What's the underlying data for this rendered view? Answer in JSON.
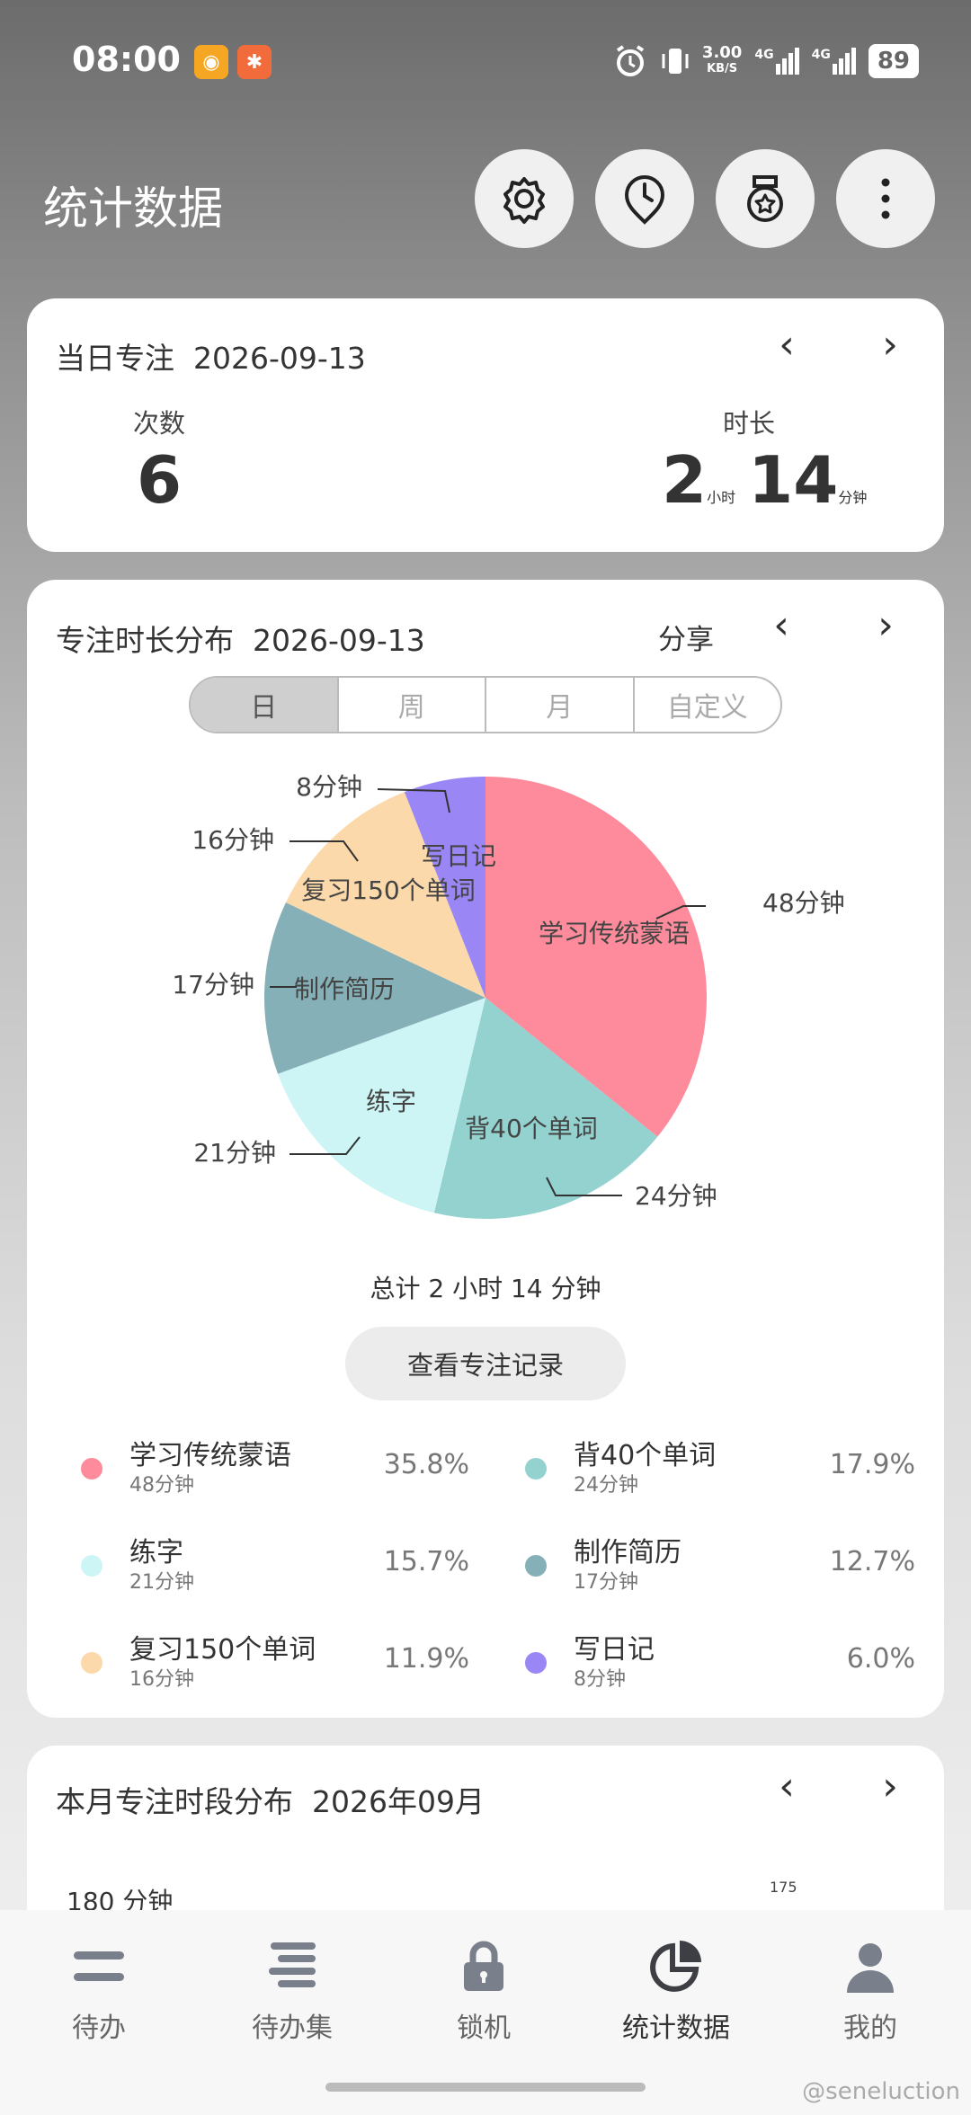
{
  "status": {
    "time": "08:00",
    "net_speed_top": "3.00",
    "net_speed_bottom": "KB/S",
    "sig1": "4G",
    "sig2": "4G",
    "battery": "89"
  },
  "header": {
    "title": "统计数据"
  },
  "daily": {
    "title": "当日专注",
    "date": "2026-09-13",
    "count_label": "次数",
    "count": "6",
    "duration_label": "时长",
    "hours": "2",
    "hours_unit": "小时",
    "minutes": "14",
    "minutes_unit": "分钟"
  },
  "distribution": {
    "title": "专注时长分布",
    "date": "2026-09-13",
    "share": "分享",
    "tabs": [
      "日",
      "周",
      "月",
      "自定义"
    ],
    "total": "总计 2 小时 14 分钟",
    "view_records": "查看专注记录"
  },
  "chart_data": {
    "type": "pie",
    "labels": [
      "学习传统蒙语",
      "背40个单词",
      "练字",
      "制作简历",
      "复习150个单词",
      "写日记"
    ],
    "values": [
      48,
      24,
      21,
      17,
      16,
      8
    ],
    "value_labels": [
      "48分钟",
      "24分钟",
      "21分钟",
      "17分钟",
      "16分钟",
      "8分钟"
    ],
    "percentages": [
      "35.8%",
      "17.9%",
      "15.7%",
      "12.7%",
      "11.9%",
      "6.0%"
    ],
    "colors": [
      "#fd8b9b",
      "#93d2cf",
      "#cdf5f5",
      "#86b0b7",
      "#fcd9aa",
      "#9a86f5"
    ]
  },
  "monthly": {
    "title": "本月专注时段分布",
    "date": "2026年09月",
    "y_max_label": "180 分钟",
    "peak_label": "175"
  },
  "nav": [
    {
      "label": "待办"
    },
    {
      "label": "待办集"
    },
    {
      "label": "锁机"
    },
    {
      "label": "统计数据"
    },
    {
      "label": "我的"
    }
  ],
  "watermark": "@seneluction"
}
